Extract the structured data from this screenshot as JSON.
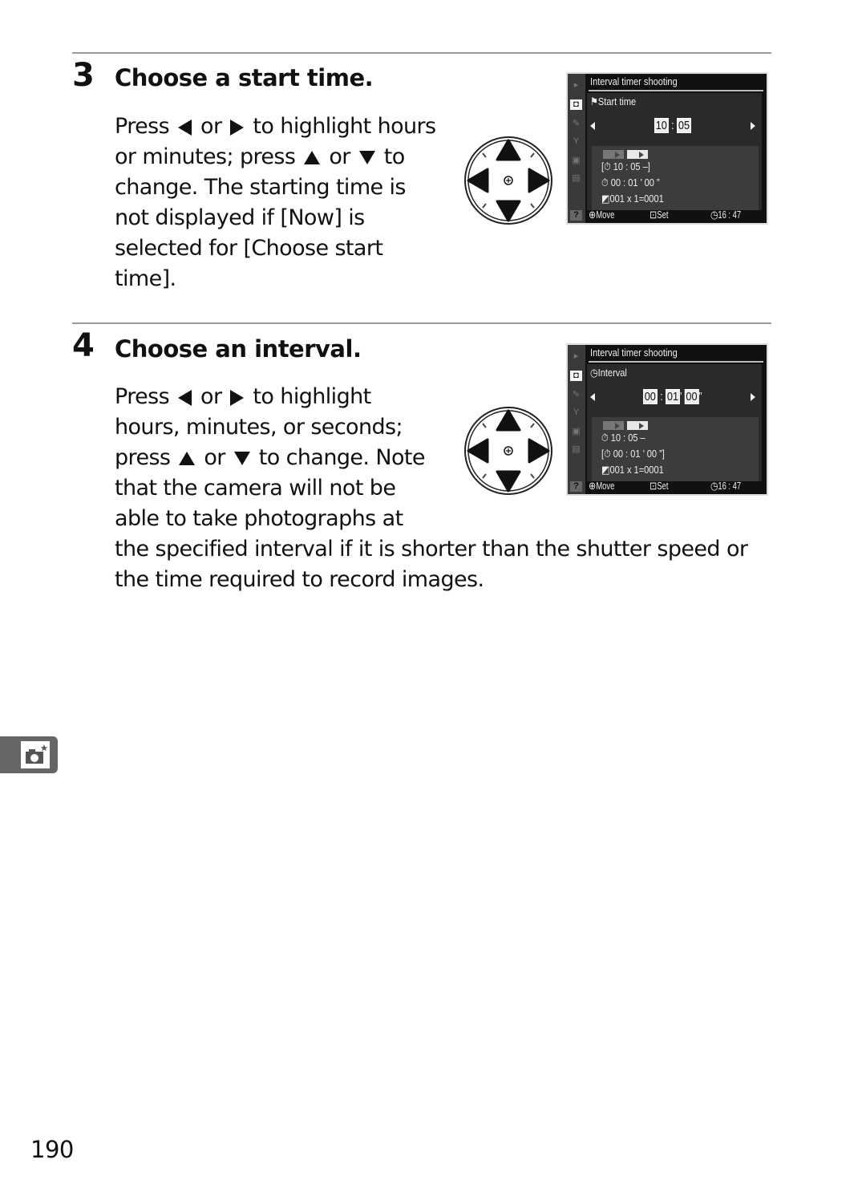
{
  "steps": [
    {
      "number": "3",
      "title": "Choose a start time.",
      "text": {
        "l1a": "Press",
        "l1b": "or",
        "l1c": "to highlight hours",
        "l2a": "or minutes; press",
        "l2b": "or",
        "l2c": "to",
        "l3": "change.  The starting time is",
        "l4": "not displayed if [Now] is",
        "l5": "selected for [Choose start",
        "l6": "time]."
      },
      "screen": {
        "title": "Interval timer shooting",
        "subtitle": "Start time",
        "subtitle_icon": "start-time-flag-icon",
        "value": {
          "hours": "10",
          "sep1": ":",
          "minutes": "05"
        },
        "summary": {
          "start": "[⏱ 10 : 05  –]",
          "interval": "⏱ 00 : 01 ’ 00 ”",
          "shots": "001 x 1=0001"
        },
        "footer": {
          "move": "Move",
          "set": "Set",
          "clock": "16 : 47"
        }
      }
    },
    {
      "number": "4",
      "title": "Choose an interval.",
      "text": {
        "l1a": "Press",
        "l1b": "or",
        "l1c": "to highlight",
        "l2": "hours, minutes, or seconds;",
        "l3a": "press",
        "l3b": "or",
        "l3c": "to change.  Note",
        "l4": "that the camera will not be",
        "l5": "able to take photographs at",
        "l6": "the specified interval if it is shorter than the shutter speed or",
        "l7": "the time required to record images."
      },
      "screen": {
        "title": "Interval timer shooting",
        "subtitle": "Interval",
        "subtitle_icon": "interval-clock-icon",
        "value": {
          "hours": "00",
          "sep1": ":",
          "minutes": "01",
          "sep2": "’",
          "seconds": "00",
          "sep3": "”"
        },
        "summary": {
          "start": "⏱ 10 : 05  –",
          "interval": "[⏱ 00 : 01 ’ 00 ”]",
          "shots": "001 x 1=0001"
        },
        "footer": {
          "move": "Move",
          "set": "Set",
          "clock": "16 : 47"
        }
      }
    }
  ],
  "page_number": "190",
  "side_tab_icon": "shooting-menu-camera-icon"
}
